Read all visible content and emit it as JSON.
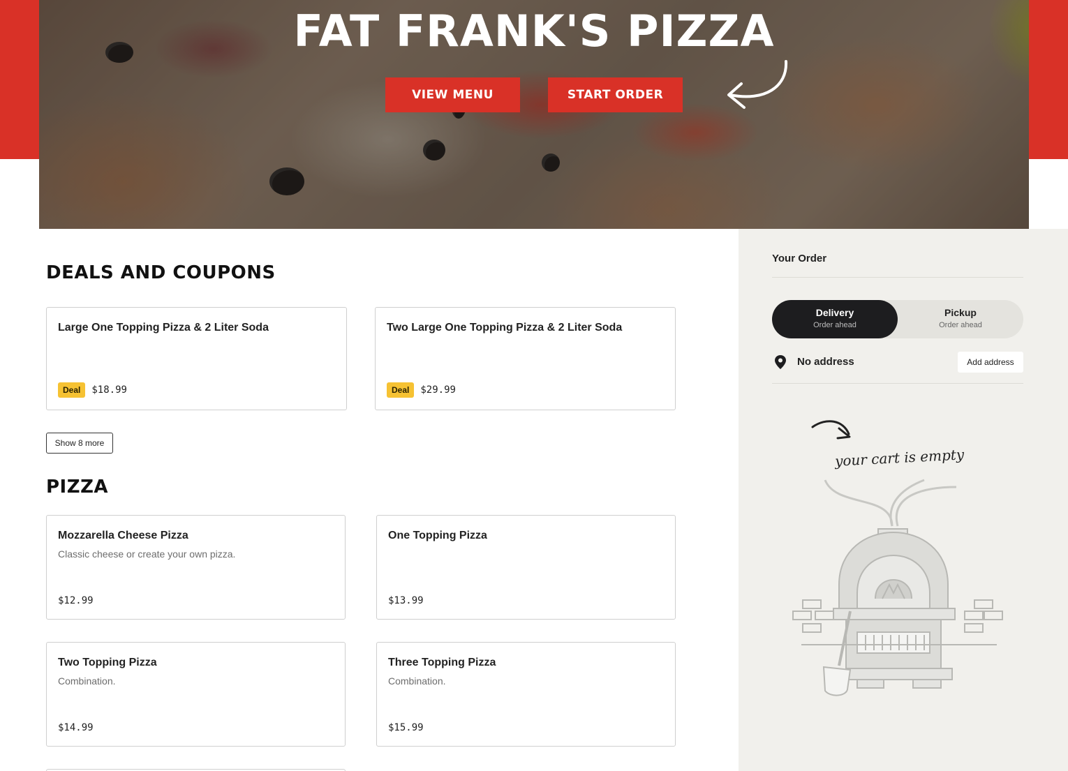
{
  "hero": {
    "title": "FAT FRANK'S PIZZA",
    "view_menu_label": "VIEW MENU",
    "start_order_label": "START ORDER"
  },
  "deals": {
    "heading": "DEALS AND COUPONS",
    "items": [
      {
        "name": "Large One Topping Pizza & 2 Liter Soda",
        "badge": "Deal",
        "price": "$18.99"
      },
      {
        "name": "Two Large One Topping Pizza & 2 Liter Soda",
        "badge": "Deal",
        "price": "$29.99"
      }
    ],
    "show_more_label": "Show 8 more"
  },
  "pizza": {
    "heading": "PIZZA",
    "items": [
      {
        "name": "Mozzarella Cheese Pizza",
        "desc": "Classic cheese or create your own pizza.",
        "price": "$12.99"
      },
      {
        "name": "One Topping Pizza",
        "desc": "",
        "price": "$13.99"
      },
      {
        "name": "Two Topping Pizza",
        "desc": "Combination.",
        "price": "$14.99"
      },
      {
        "name": "Three Topping Pizza",
        "desc": "Combination.",
        "price": "$15.99"
      }
    ]
  },
  "order": {
    "title": "Your Order",
    "delivery_label": "Delivery",
    "delivery_sub": "Order ahead",
    "pickup_label": "Pickup",
    "pickup_sub": "Order ahead",
    "address_text": "No address",
    "add_address_label": "Add address",
    "empty_text": "your cart is empty"
  },
  "colors": {
    "brand_red": "#d93127",
    "deal_yellow": "#f6c233",
    "sidebar_bg": "#f1f0ec",
    "toggle_active": "#1d1d1f"
  },
  "icons": [
    "curved-arrow-icon",
    "location-pin-icon",
    "pizza-oven-illustration"
  ]
}
